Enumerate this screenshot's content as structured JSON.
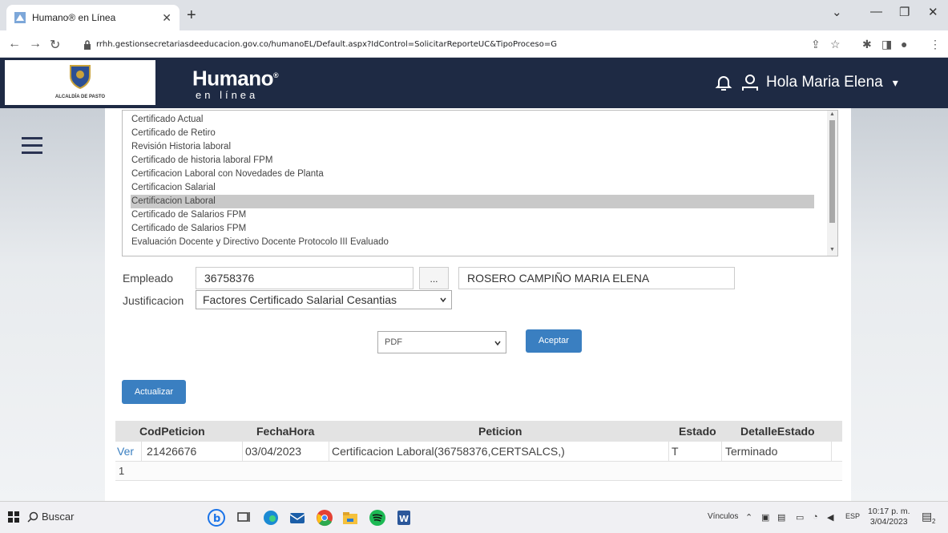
{
  "browser": {
    "tab_title": "Humano® en Línea",
    "url": "rrhh.gestionsecretariasdeeducacion.gov.co/humanoEL/Default.aspx?IdControl=SolicitarReporteUC&TipoProceso=G"
  },
  "header": {
    "logo_text": "ALCALDÍA DE PASTO",
    "brand_main": "Humano",
    "brand_sup": "®",
    "brand_sub": "en línea",
    "greeting": "Hola Maria Elena"
  },
  "report_list": {
    "items": [
      "Certificado Actual",
      "Certificado de Retiro",
      "Revisión Historia laboral",
      "Certificado de historia laboral FPM",
      "Certificacion Laboral con Novedades de Planta",
      "Certificacion Salarial",
      "Certificacion Laboral",
      "Certificado de Salarios FPM",
      "Certificado de Salarios FPM",
      "Evaluación Docente y Directivo Docente Protocolo III Evaluado"
    ],
    "selected_index": 6
  },
  "form": {
    "empleado_label": "Empleado",
    "empleado_value": "36758376",
    "lookup_label": "...",
    "employee_name": "ROSERO CAMPIÑO MARIA ELENA",
    "justificacion_label": "Justificacion",
    "justificacion_value": "Factores Certificado Salarial Cesantias",
    "format_value": "PDF",
    "accept_label": "Aceptar",
    "refresh_label": "Actualizar"
  },
  "table": {
    "headers": [
      "CodPeticion",
      "FechaHora",
      "Peticion",
      "Estado",
      "DetalleEstado"
    ],
    "rows": [
      {
        "action": "Ver",
        "cod": "21426676",
        "fecha": "03/04/2023",
        "peticion": "Certificacion Laboral(36758376,CERTSALCS,)",
        "estado": "T",
        "detalle": "Terminado"
      }
    ],
    "page": "1"
  },
  "taskbar": {
    "search_label": "Buscar",
    "links_label": "Vínculos",
    "lang": "ESP",
    "time": "10:17 p. m.",
    "date": "3/04/2023",
    "notif_count": "2"
  },
  "colors": {
    "header_bg": "#1e2a44",
    "accent": "#3a7fc1",
    "selected_item": "#c9c9c9"
  }
}
